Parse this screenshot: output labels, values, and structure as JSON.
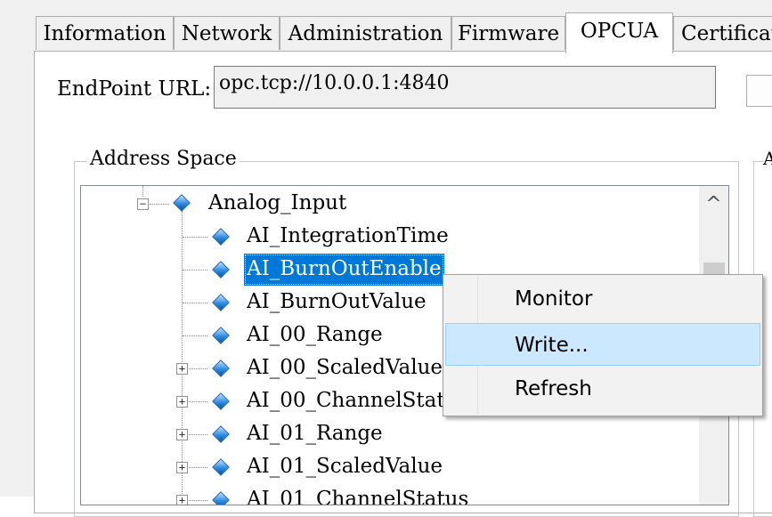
{
  "tabs": [
    "Information",
    "Network",
    "Administration",
    "Firmware",
    "OPCUA",
    "Certificat"
  ],
  "active_tab": "OPCUA",
  "endpoint": {
    "label": "EndPoint URL:",
    "value": "opc.tcp://10.0.0.1:4840"
  },
  "address_space": {
    "title": "Address Space",
    "right_group_title": "A",
    "tree": {
      "root": "Analog_Input",
      "items": [
        "AI_IntegrationTime",
        "AI_BurnOutEnable",
        "AI_BurnOutValue",
        "AI_00_Range",
        "AI_00_ScaledValue",
        "AI_00_ChannelStat",
        "AI_01_Range",
        "AI_01_ScaledValue",
        "AI_01_ChannelStatus"
      ],
      "selected": "AI_BurnOutEnable"
    },
    "scroll_up_glyph": "^"
  },
  "context_menu": {
    "items": [
      "Monitor",
      "Write...",
      "Refresh"
    ],
    "highlighted": "Write..."
  },
  "icons": {
    "collapse": "−",
    "expand": "+",
    "node": "opc-node-icon"
  }
}
